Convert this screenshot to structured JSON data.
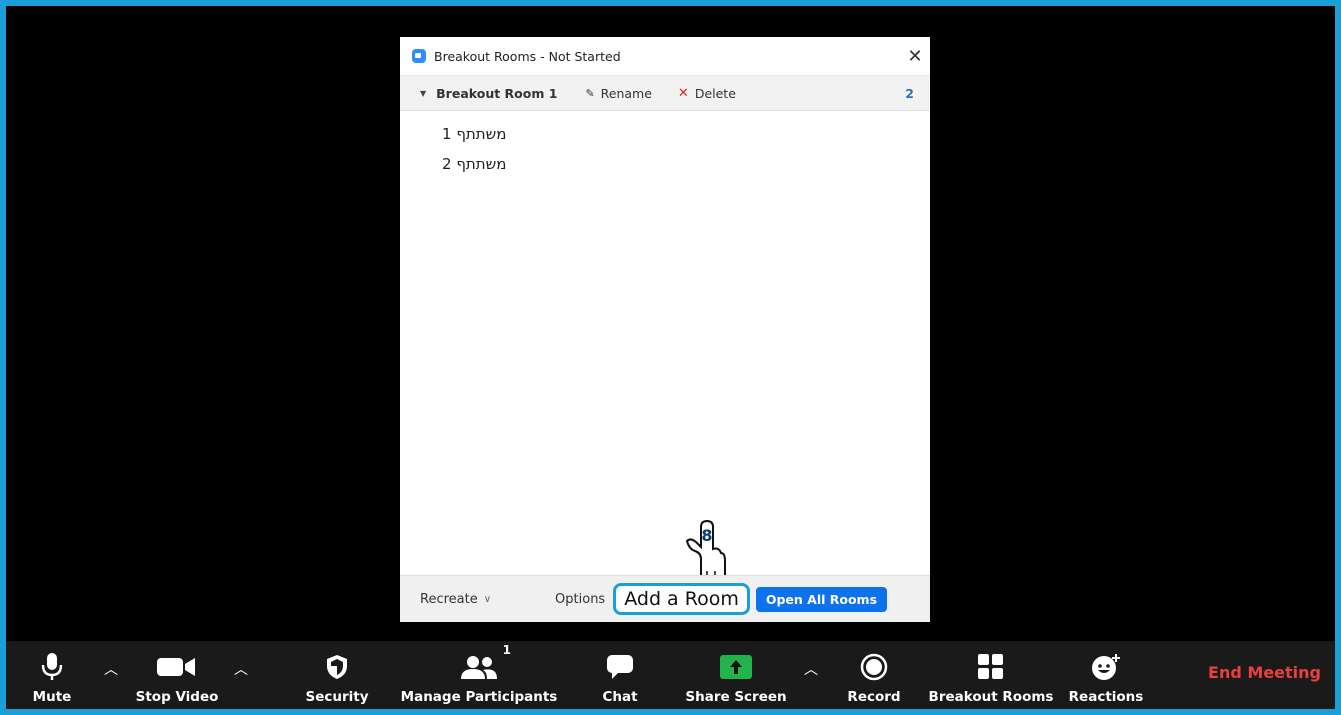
{
  "dialog": {
    "title": "Breakout Rooms - Not Started",
    "close_glyph": "✕",
    "room": {
      "name": "Breakout Room 1",
      "rename_label": "Rename",
      "delete_label": "Delete",
      "count": "2",
      "participants": [
        "משתתף 1",
        "משתתף 2"
      ]
    },
    "footer": {
      "recreate_label": "Recreate",
      "options_label": "Options",
      "add_room_label": "Add a Room",
      "open_all_label": "Open All Rooms"
    },
    "pointer_step": "8"
  },
  "toolbar": {
    "mute": "Mute",
    "stop_video": "Stop Video",
    "security": "Security",
    "manage_participants": "Manage Participants",
    "participant_count": "1",
    "chat": "Chat",
    "share_screen": "Share Screen",
    "record": "Record",
    "breakout_rooms": "Breakout Rooms",
    "reactions": "Reactions",
    "end_meeting": "End Meeting"
  },
  "colors": {
    "frame": "#1aa0d8",
    "accent_blue": "#0e72ed",
    "share_green": "#22b34a",
    "end_red": "#e8413d"
  }
}
